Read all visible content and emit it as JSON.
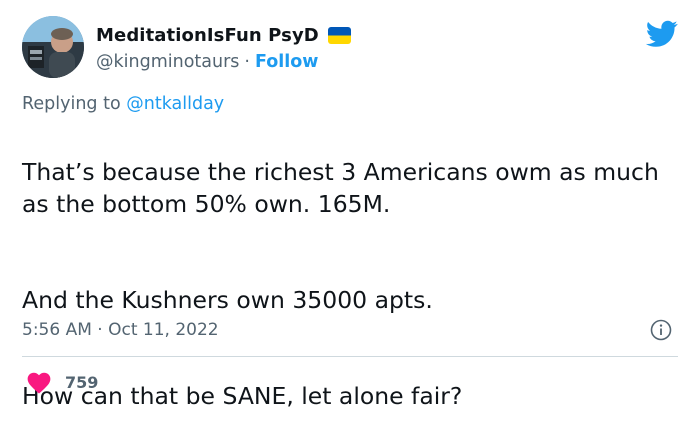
{
  "author": {
    "display_name": "MeditationIsFun PsyD",
    "handle": "@kingminotaurs",
    "separator": "·",
    "follow_label": "Follow",
    "flag": "ukraine-flag-icon"
  },
  "reply": {
    "prefix": "Replying to",
    "mention": "@ntkallday"
  },
  "body": {
    "paragraph_1": "That’s because the richest 3 Americans owm as much as the bottom 50% own. 165M.",
    "paragraph_2": "And the Kushners own 35000 apts.",
    "paragraph_3": "How can that be SANE, let alone fair?"
  },
  "meta": {
    "timestamp": "5:56 AM · Oct 11, 2022"
  },
  "engagement": {
    "like_count": "759"
  },
  "colors": {
    "twitter_blue": "#1d9bf0",
    "secondary_text": "#536471",
    "like_red": "#f91880",
    "flag_blue": "#0057b7",
    "flag_yellow": "#ffd700"
  }
}
